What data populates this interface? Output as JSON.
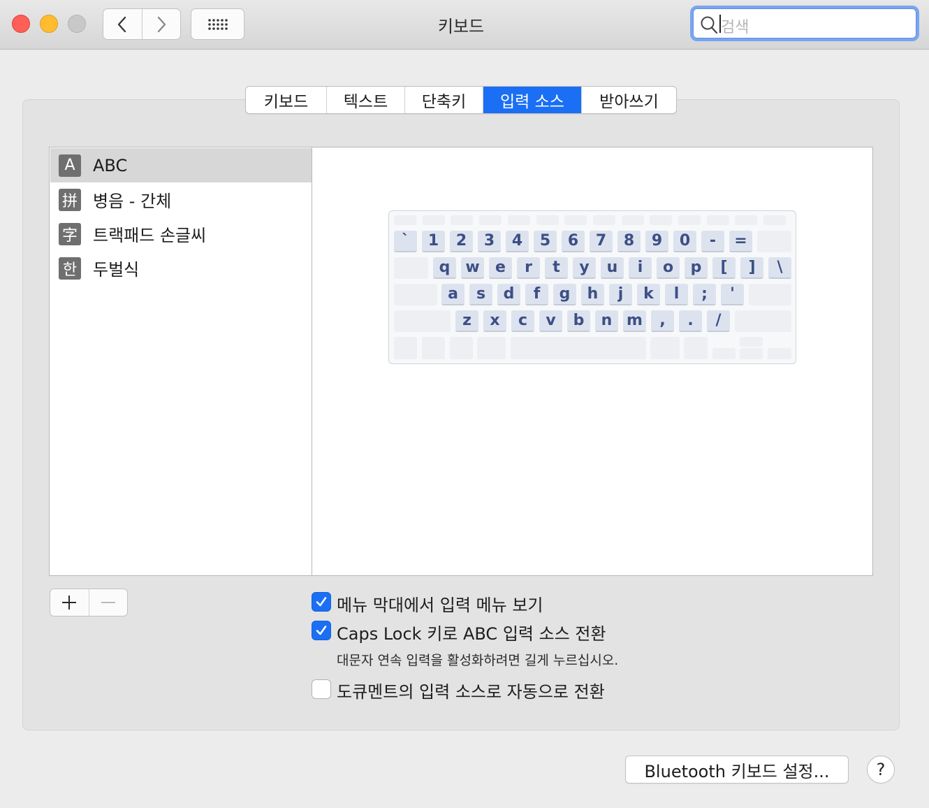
{
  "window": {
    "title": "키보드"
  },
  "search": {
    "placeholder": "검색"
  },
  "tabs": [
    {
      "label": "키보드",
      "active": false
    },
    {
      "label": "텍스트",
      "active": false
    },
    {
      "label": "단축키",
      "active": false
    },
    {
      "label": "입력 소스",
      "active": true
    },
    {
      "label": "받아쓰기",
      "active": false
    }
  ],
  "input_sources": [
    {
      "icon_char": "A",
      "label": "ABC",
      "selected": true
    },
    {
      "icon_char": "拼",
      "label": "병음 - 간체",
      "selected": false
    },
    {
      "icon_char": "字",
      "label": "트랙패드 손글씨",
      "selected": false
    },
    {
      "icon_char": "한",
      "label": "두벌식",
      "selected": false
    }
  ],
  "keyboard": {
    "row1": [
      "`",
      "1",
      "2",
      "3",
      "4",
      "5",
      "6",
      "7",
      "8",
      "9",
      "0",
      "-",
      "="
    ],
    "row2": [
      "q",
      "w",
      "e",
      "r",
      "t",
      "y",
      "u",
      "i",
      "o",
      "p",
      "[",
      "]",
      "\\"
    ],
    "row3": [
      "a",
      "s",
      "d",
      "f",
      "g",
      "h",
      "j",
      "k",
      "l",
      ";",
      "'"
    ],
    "row4": [
      "z",
      "x",
      "c",
      "v",
      "b",
      "n",
      "m",
      ",",
      ".",
      "/"
    ]
  },
  "options": {
    "show_menu": {
      "label": "메뉴 막대에서 입력 메뉴 보기",
      "checked": true
    },
    "caps_lock": {
      "label": "Caps Lock 키로 ABC 입력 소스 전환",
      "checked": true
    },
    "caps_lock_hint": "대문자 연속 입력을 활성화하려면 길게 누르십시오.",
    "auto_switch": {
      "label": "도큐멘트의 입력 소스로 자동으로 전환",
      "checked": false
    }
  },
  "buttons": {
    "bluetooth": "Bluetooth 키보드 설정...",
    "help": "?"
  },
  "colors": {
    "accent": "#1a6ff5",
    "key_text": "#3d4f86"
  }
}
